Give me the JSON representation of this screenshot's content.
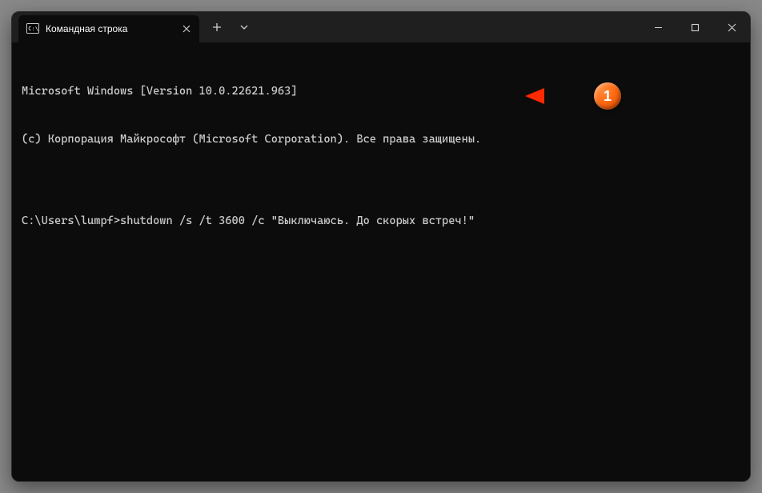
{
  "tab": {
    "title": "Командная строка"
  },
  "terminal": {
    "line1": "Microsoft Windows [Version 10.0.22621.963]",
    "line2": "(c) Корпорация Майкрософт (Microsoft Corporation). Все права защищены.",
    "blank": "",
    "prompt": "C:\\Users\\lumpf>",
    "command": "shutdown /s /t 3600 /c \"Выключаюсь. До скорых встреч!\""
  },
  "annotation": {
    "number": "1"
  }
}
